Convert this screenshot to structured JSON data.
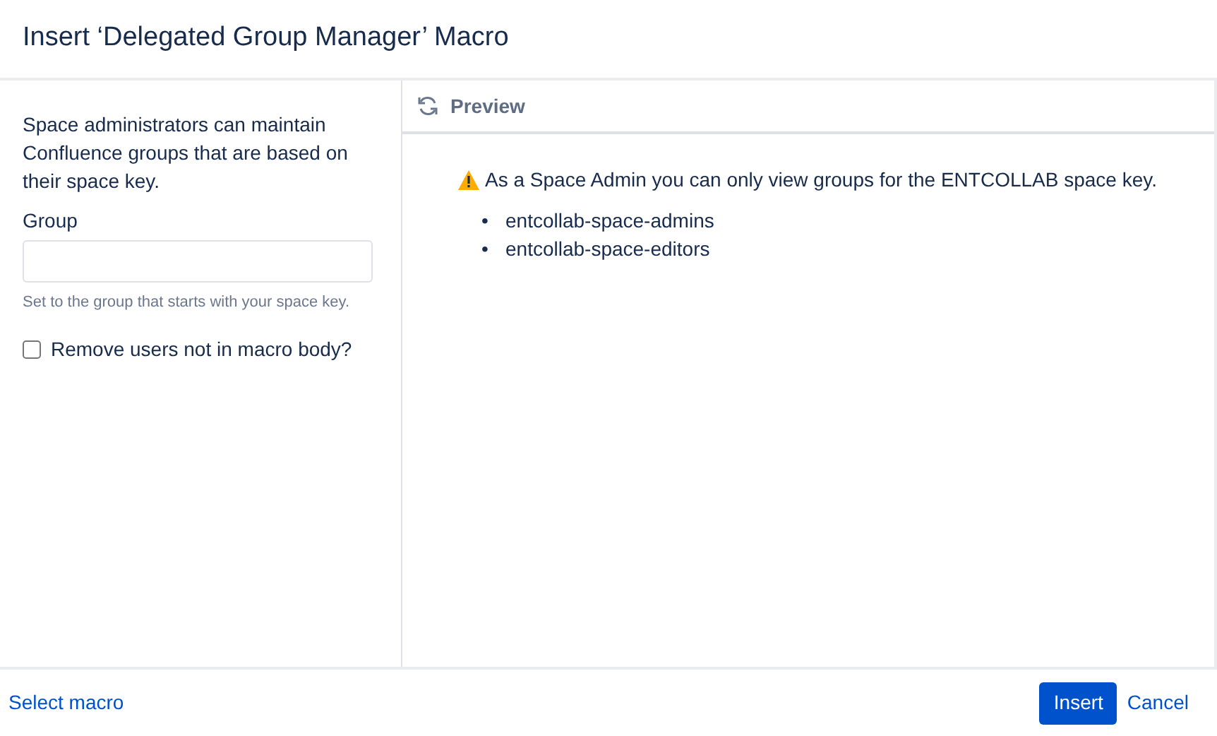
{
  "dialog": {
    "title": "Insert ‘Delegated Group Manager’ Macro"
  },
  "form": {
    "description": "Space administrators can maintain Confluence groups that are based on their space key.",
    "field_label": "Group",
    "help": "Set to the group that starts with your space key.",
    "checkbox": {
      "label": "Remove users not in macro body?",
      "checked": false
    }
  },
  "preview": {
    "title": "Preview",
    "warning": "As a Space Admin you can only view groups for the ENTCOLLAB space key.",
    "groups": [
      {
        "marker": "•",
        "name": "entcollab-space-admins"
      },
      {
        "marker": "•",
        "name": "entcollab-space-editors"
      }
    ]
  },
  "footer": {
    "link": "Select macro",
    "primary_button": "Insert",
    "cancel": "Cancel"
  }
}
